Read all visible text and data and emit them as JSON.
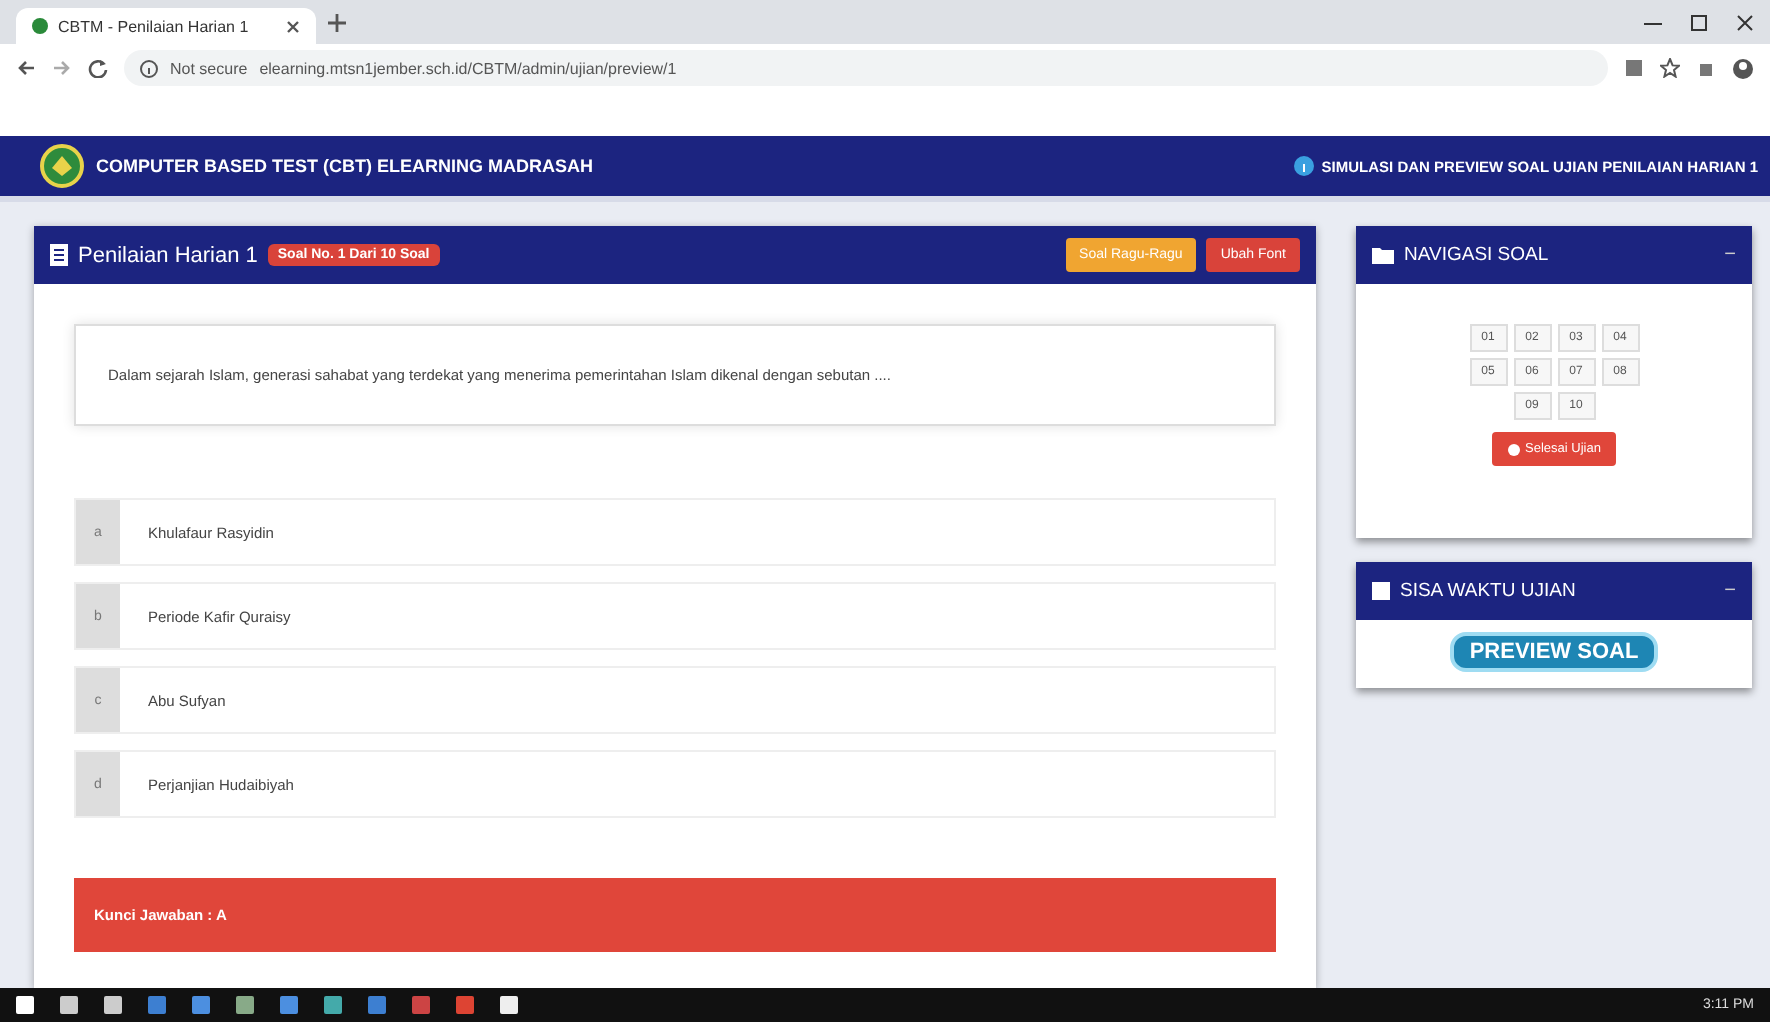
{
  "browser": {
    "tab_title": "CBTM - Penilaian Harian 1",
    "security": "Not secure",
    "url": "elearning.mtsn1jember.sch.id/CBTM/admin/ujian/preview/1"
  },
  "header": {
    "title": "COMPUTER BASED TEST (CBT) ELEARNING MADRASAH",
    "subtitle": "SIMULASI DAN PREVIEW SOAL UJIAN PENILAIAN HARIAN 1"
  },
  "question_panel": {
    "title": "Penilaian Harian 1",
    "badge": "Soal No. 1 Dari 10 Soal",
    "buttons": [
      {
        "label": "Soal Ragu-Ragu",
        "kind": "warning"
      },
      {
        "label": "Ubah Font",
        "kind": "danger"
      }
    ],
    "question": "Dalam sejarah Islam, generasi sahabat yang terdekat yang menerima pemerintahan Islam dikenal dengan sebutan ....",
    "options": [
      {
        "letter": "a",
        "text": "Khulafaur Rasyidin"
      },
      {
        "letter": "b",
        "text": "Periode Kafir Quraisy"
      },
      {
        "letter": "c",
        "text": "Abu Sufyan"
      },
      {
        "letter": "d",
        "text": "Perjanjian Hudaibiyah"
      }
    ],
    "answer_key": "Kunci Jawaban : A"
  },
  "navigation_panel": {
    "title": "NAVIGASI SOAL",
    "collapse": "−",
    "numbers": [
      "01",
      "02",
      "03",
      "04",
      "05",
      "06",
      "07",
      "08",
      "09",
      "10"
    ],
    "finish_button": "Selesai Ujian"
  },
  "timer_panel": {
    "title": "SISA WAKTU UJIAN",
    "collapse": "−",
    "badge": "PREVIEW SOAL"
  },
  "taskbar": {
    "clock": "3:11 PM"
  }
}
